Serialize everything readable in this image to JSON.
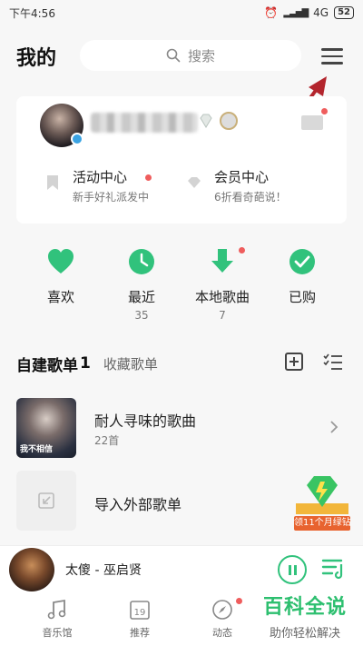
{
  "status_bar": {
    "time": "下午4:56",
    "network": "4G",
    "battery": "52"
  },
  "header": {
    "title": "我的",
    "search_placeholder": "搜索"
  },
  "profile": {
    "promos": [
      {
        "title": "活动中心",
        "subtitle": "新手好礼派发中"
      },
      {
        "title": "会员中心",
        "subtitle": "6折看奇葩说！"
      }
    ]
  },
  "quick_actions": [
    {
      "label": "喜欢",
      "count": ""
    },
    {
      "label": "最近",
      "count": "35"
    },
    {
      "label": "本地歌曲",
      "count": "7"
    },
    {
      "label": "已购",
      "count": ""
    }
  ],
  "playlists": {
    "tab_created": "自建歌单",
    "tab_created_count": "1",
    "tab_collected": "收藏歌单",
    "items": [
      {
        "title": "耐人寻味的歌曲",
        "subtitle": "22首",
        "cover_text": "我不相信"
      },
      {
        "title": "导入外部歌单",
        "subtitle": ""
      }
    ]
  },
  "ad": {
    "text": "领11个月绿钻"
  },
  "player": {
    "song": "太傻 - 巫启贤"
  },
  "tab_bar": [
    {
      "label": "音乐馆",
      "icon": "music-note-icon"
    },
    {
      "label": "推荐",
      "icon": "calendar-icon"
    },
    {
      "label": "动态",
      "icon": "compass-icon"
    }
  ],
  "calendar_day": "19",
  "watermark": {
    "title": "百科全说",
    "subtitle": "助你轻松解决"
  },
  "colors": {
    "accent": "#31c27c",
    "red_dot": "#ef5d5d",
    "arrow": "#b3252d"
  }
}
